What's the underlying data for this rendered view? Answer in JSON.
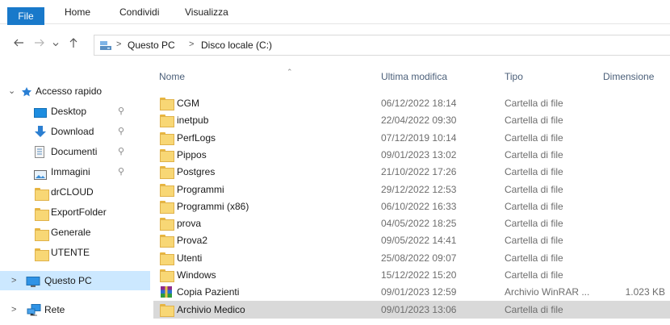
{
  "ribbon": {
    "tabs": [
      "File",
      "Home",
      "Condividi",
      "Visualizza"
    ]
  },
  "address": {
    "crumbs": [
      "Questo PC",
      "Disco locale (C:)"
    ]
  },
  "nav_pane": {
    "quick_access": "Accesso rapido",
    "pinned": [
      "Desktop",
      "Download",
      "Documenti",
      "Immagini"
    ],
    "folders": [
      "drCLOUD",
      "ExportFolder",
      "Generale",
      "UTENTE"
    ],
    "this_pc": "Questo PC",
    "network": "Rete"
  },
  "columns": {
    "name": "Nome",
    "modified": "Ultima modifica",
    "type": "Tipo",
    "size": "Dimensione"
  },
  "files": [
    {
      "name": "CGM",
      "modified": "06/12/2022 18:14",
      "type": "Cartella di file",
      "size": "",
      "icon": "folder-icon"
    },
    {
      "name": "inetpub",
      "modified": "22/04/2022 09:30",
      "type": "Cartella di file",
      "size": "",
      "icon": "folder-icon"
    },
    {
      "name": "PerfLogs",
      "modified": "07/12/2019 10:14",
      "type": "Cartella di file",
      "size": "",
      "icon": "folder-icon"
    },
    {
      "name": "Pippos",
      "modified": "09/01/2023 13:02",
      "type": "Cartella di file",
      "size": "",
      "icon": "folder-icon"
    },
    {
      "name": "Postgres",
      "modified": "21/10/2022 17:26",
      "type": "Cartella di file",
      "size": "",
      "icon": "folder-icon"
    },
    {
      "name": "Programmi",
      "modified": "29/12/2022 12:53",
      "type": "Cartella di file",
      "size": "",
      "icon": "folder-icon"
    },
    {
      "name": "Programmi (x86)",
      "modified": "06/10/2022 16:33",
      "type": "Cartella di file",
      "size": "",
      "icon": "folder-icon"
    },
    {
      "name": "prova",
      "modified": "04/05/2022 18:25",
      "type": "Cartella di file",
      "size": "",
      "icon": "folder-icon"
    },
    {
      "name": "Prova2",
      "modified": "09/05/2022 14:41",
      "type": "Cartella di file",
      "size": "",
      "icon": "folder-icon"
    },
    {
      "name": "Utenti",
      "modified": "25/08/2022 09:07",
      "type": "Cartella di file",
      "size": "",
      "icon": "folder-icon"
    },
    {
      "name": "Windows",
      "modified": "15/12/2022 15:20",
      "type": "Cartella di file",
      "size": "",
      "icon": "folder-icon"
    },
    {
      "name": "Copia Pazienti",
      "modified": "09/01/2023 12:59",
      "type": "Archivio WinRAR ...",
      "size": "1.023 KB",
      "icon": "winrar-icon"
    },
    {
      "name": "Archivio Medico",
      "modified": "09/01/2023 13:06",
      "type": "Cartella di file",
      "size": "",
      "icon": "folder-icon"
    }
  ],
  "colors": {
    "file_tab": "#1979ca",
    "selection_nav": "#cce8ff",
    "selection_row": "#d9d9d9",
    "folder": "#f8d775"
  }
}
